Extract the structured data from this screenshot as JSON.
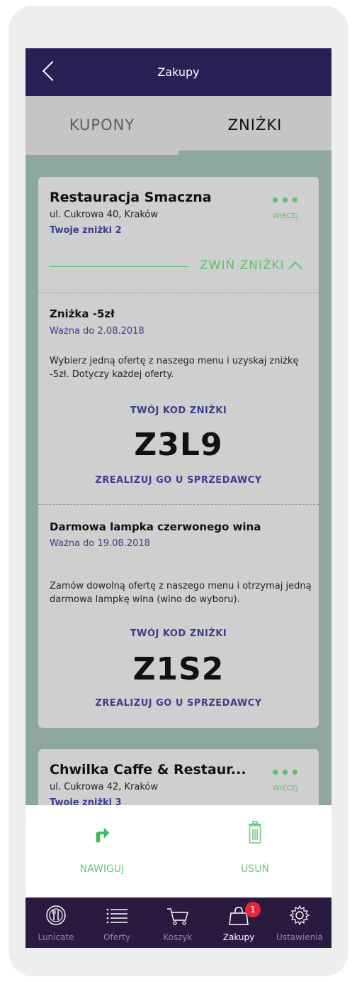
{
  "header": {
    "title": "Zakupy",
    "back_icon": "chevron-left-icon"
  },
  "tabs": [
    {
      "label": "KUPONY",
      "active": false
    },
    {
      "label": "ZNIŻKI",
      "active": true
    }
  ],
  "cards": [
    {
      "name": "Restauracja Smaczna",
      "address": "ul. Cukrowa 40, Kraków",
      "count": "Twoje zniżki 2",
      "more_label": "WIĘCEJ",
      "collapse_label": "ZWIŃ ZNIŻKI",
      "discounts": [
        {
          "title": "Zniżka -5zł",
          "valid": "Ważna do 2.08.2018",
          "description": "Wybierz jedną ofertę z naszego menu i uzyskaj zniżkę -5zł. Dotyczy każdej oferty.",
          "code_label": "TWÓJ KOD ZNIŻKI",
          "code": "Z3L9",
          "redeem": "ZREALIZUJ GO U SPRZEDAWCY"
        },
        {
          "title": "Darmowa lampka czerwonego wina",
          "valid": "Ważna do 19.08.2018",
          "description": "Zamów dowolną ofertę z naszego menu i otrzymaj jedną darmowa lampkę wina (wino do wyboru).",
          "code_label": "TWÓJ KOD ZNIŻKI",
          "code": "Z1S2",
          "redeem": "ZREALIZUJ GO U SPRZEDAWCY"
        }
      ]
    },
    {
      "name": "Chwilka Caffe & Restaur...",
      "address": "ul. Cukrowa 42, Kraków",
      "count": "Twoje zniżki 3",
      "more_label": "WIĘCEJ"
    }
  ],
  "actions": [
    {
      "label": "NAWIGUJ",
      "icon": "navigate-arrow-icon"
    },
    {
      "label": "USUŃ",
      "icon": "trash-icon"
    }
  ],
  "tabbar": [
    {
      "label": "Lunicate",
      "icon": "plate-fork-knife-icon",
      "active": false
    },
    {
      "label": "Oferty",
      "icon": "list-icon",
      "active": false
    },
    {
      "label": "Koszyk",
      "icon": "cart-icon",
      "active": false
    },
    {
      "label": "Zakupy",
      "icon": "shopping-bag-icon",
      "active": true,
      "badge": "1"
    },
    {
      "label": "Ustawienia",
      "icon": "gear-icon",
      "active": false
    }
  ],
  "colors": {
    "header": "#2a2055",
    "accent_green": "#5ac26e",
    "link_blue": "#3d3d8e",
    "badge_red": "#e8253b"
  }
}
